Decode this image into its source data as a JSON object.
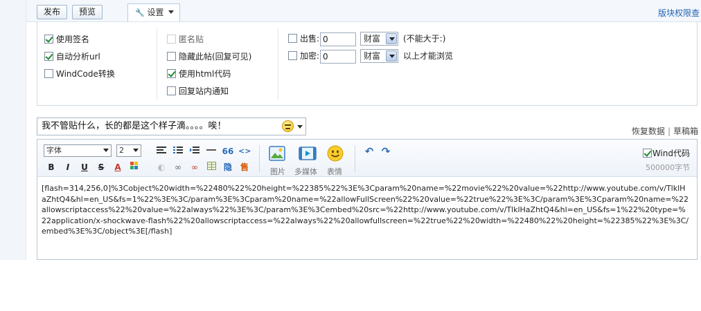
{
  "topbar": {
    "publish_label": "发布",
    "preview_label": "预览",
    "settings_tab_label": "设置",
    "permission_link": "版块权限查"
  },
  "settings": {
    "col1": [
      {
        "label": "使用签名",
        "checked": true
      },
      {
        "label": "自动分析url",
        "checked": true
      },
      {
        "label": "WindCode转换",
        "checked": false
      }
    ],
    "col2": [
      {
        "label": "匿名贴",
        "checked": false,
        "disabled": true
      },
      {
        "label": "隐藏此帖(回复可见)",
        "checked": false
      },
      {
        "label": "使用html代码",
        "checked": true
      },
      {
        "label": "回复站内通知",
        "checked": false
      }
    ],
    "sell": {
      "label": "出售:",
      "value": "0",
      "currency": "财富",
      "hint": "(不能大于:)"
    },
    "encrypt": {
      "label": "加密:",
      "value": "0",
      "currency": "财富",
      "hint": "以上才能浏览"
    }
  },
  "title": {
    "value": "我不管贴什么，长的都是这个样子滴。。。。唉！"
  },
  "side_links": {
    "restore": "恢复数据",
    "sep": "|",
    "drafts": "草稿箱"
  },
  "toolbar": {
    "font_select": "字体",
    "size_select": "2",
    "picture_label": "图片",
    "media_label": "多媒体",
    "emotion_label": "表情",
    "wind_code_label": "Wind代码",
    "wind_code_checked": true,
    "byte_limit": "500000字节"
  },
  "editor": {
    "content": "[flash=314,256,0]%3Cobject%20width=%22480%22%20height=%22385%22%3E%3Cparam%20name=%22movie%22%20value=%22http://www.youtube.com/v/TlklHaZhtQ4&hl=en_US&fs=1%22%3E%3C/param%3E%3Cparam%20name=%22allowFullScreen%22%20value=%22true%22%3E%3C/param%3E%3Cparam%20name=%22allowscriptaccess%22%20value=%22always%22%3E%3C/param%3E%3Cembed%20src=%22http://www.youtube.com/v/TlklHaZhtQ4&hl=en_US&fs=1%22%20type=%22application/x-shockwave-flash%22%20allowscriptaccess=%22always%22%20allowfullscreen=%22true%22%20width=%22480%22%20height=%22385%22%3E%3C/embed%3E%3C/object%3E[/flash]"
  },
  "colors": {
    "link_blue": "#1e64b3",
    "panel_border": "#cfd8e3",
    "check_green": "#1a8a2c"
  }
}
